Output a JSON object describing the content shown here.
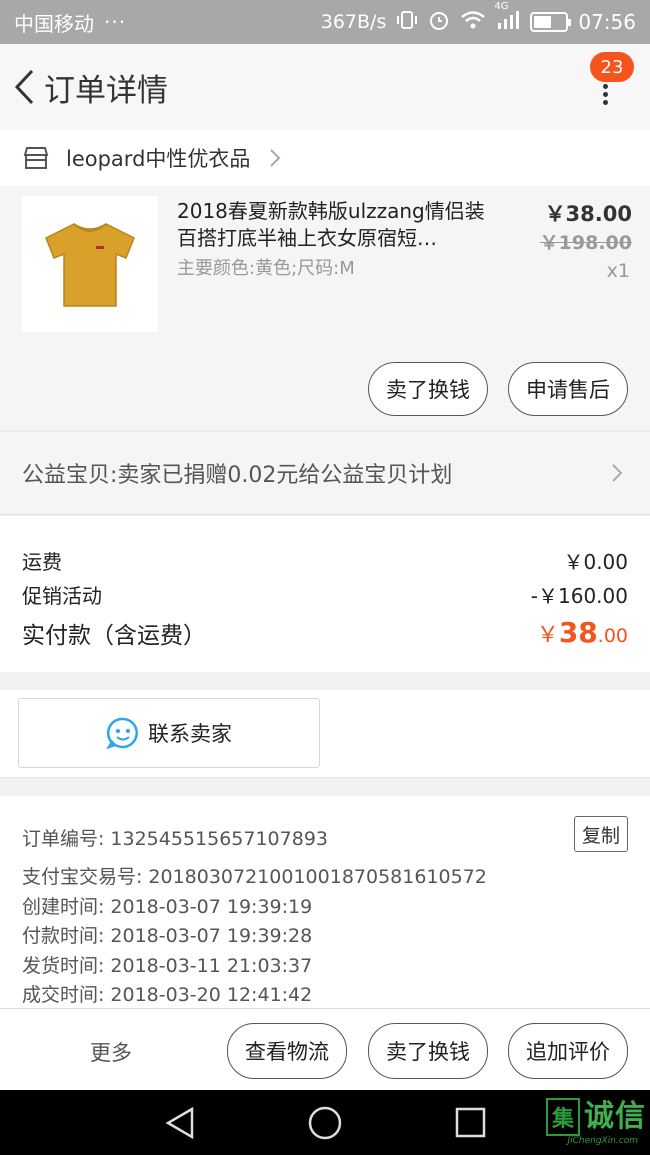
{
  "status_bar": {
    "carrier": "中国移动",
    "dots": "···",
    "net_speed": "367B/s",
    "time": "07:56",
    "network_type": "4G"
  },
  "header": {
    "title": "订单详情",
    "badge_count": "23"
  },
  "shop": {
    "name": "leopard中性优衣品"
  },
  "product": {
    "name": "2018春夏新款韩版ulzzang情侣装百搭打底半袖上衣女原宿短…",
    "spec": "主要颜色:黄色;尺码:M",
    "price": "￥38.00",
    "original_price": "￥198.00",
    "quantity": "x1",
    "buttons": {
      "sell": "卖了换钱",
      "after_sales": "申请售后"
    }
  },
  "charity": {
    "text": "公益宝贝:卖家已捐赠0.02元给公益宝贝计划"
  },
  "fees": {
    "shipping_label": "运费",
    "shipping_value": "￥0.00",
    "promo_label": "促销活动",
    "promo_value": "-￥160.00",
    "total_label": "实付款（含运费）",
    "total_currency": "￥",
    "total_int": "38",
    "total_dec": ".00"
  },
  "contact": {
    "label": "联系卖家"
  },
  "order_info": {
    "copy_label": "复制",
    "rows": [
      {
        "label": "订单编号:",
        "value": "132545515657107893"
      },
      {
        "label": "支付宝交易号:",
        "value": "2018030721001001870581610572"
      },
      {
        "label": "创建时间:",
        "value": "2018-03-07 19:39:19"
      },
      {
        "label": "付款时间:",
        "value": "2018-03-07 19:39:28"
      },
      {
        "label": "发货时间:",
        "value": "2018-03-11 21:03:37"
      },
      {
        "label": "成交时间:",
        "value": "2018-03-20 12:41:42"
      }
    ]
  },
  "action_bar": {
    "more": "更多",
    "logistics": "查看物流",
    "sell": "卖了换钱",
    "review": "追加评价"
  },
  "watermark": {
    "mark": "集",
    "text": "诚信",
    "sub": "JiChengXin.com"
  },
  "colors": {
    "accent": "#f5541c",
    "status_bar": "#a8a8a8",
    "watermark": "#2e9a3e"
  }
}
